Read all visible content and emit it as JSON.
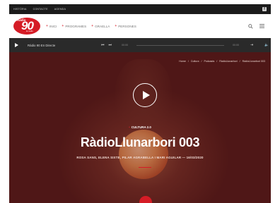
{
  "topbar": {
    "links": [
      "HISTÒRIA",
      "CONTACTE",
      "AGENDA"
    ],
    "social_icon": "facebook-icon"
  },
  "header": {
    "logo": {
      "radio": "Ràdio",
      "number": "90",
      "subtitle": "la ràdio"
    },
    "nav": [
      "INICI",
      "PROGRAMES",
      "GRAELLA",
      "PERSONES"
    ],
    "icons": [
      "search-icon",
      "menu-icon"
    ]
  },
  "player": {
    "title": "Ràdio 90 En Directe",
    "time_current": "00:00",
    "time_total": "00:00",
    "icons": [
      "play-icon",
      "prev-icon",
      "next-icon",
      "share-icon",
      "volume-icon"
    ]
  },
  "hero": {
    "breadcrumb": [
      "Home",
      "Cultura",
      "Podcasts",
      "RàdioLlunarbori",
      "RàdioLlunarbori 003"
    ],
    "category": "CULTURA 2.0",
    "headline": "RàdioLlunarbori 003",
    "byline": "ROSA SANS, ELENA SIXTE, PILAR AGRABELLA I MARI AGUILAR  —  16/03/2020"
  },
  "colors": {
    "brand": "#d51c26",
    "topbar": "#1b1b1b",
    "player": "#2a2a2a"
  }
}
